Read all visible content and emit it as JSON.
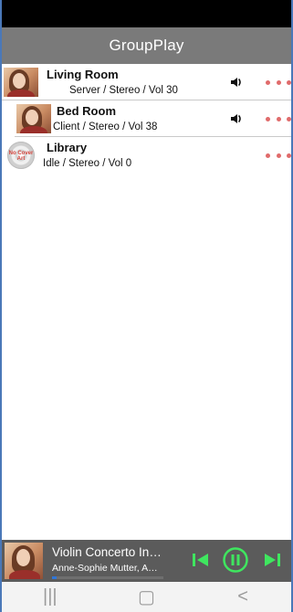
{
  "header": {
    "title": "GroupPlay"
  },
  "devices": [
    {
      "name": "Living Room",
      "status": "Server / Stereo / Vol 30",
      "artwork": "album-portrait-art",
      "volume_icon": "volume-icon",
      "more_icon": "more-options-icon"
    },
    {
      "name": "Bed Room",
      "status": "Client / Stereo / Vol 38",
      "artwork": "album-portrait-art",
      "volume_icon": "volume-icon",
      "more_icon": "more-options-icon"
    },
    {
      "name": "Library",
      "status": "Idle / Stereo / Vol 0",
      "artwork": "disc-no-cover-art",
      "artwork_label": "No Cover Art",
      "more_icon": "more-options-icon"
    }
  ],
  "player": {
    "title": "Violin Concerto In…",
    "artist": "Anne-Sophie Mutter, A…",
    "progress": 0.04,
    "controls": [
      "previous-icon",
      "pause-icon",
      "next-icon"
    ]
  },
  "navigation": {
    "recent": "|||",
    "home": "▢",
    "back": "<"
  },
  "colors": {
    "status_bar": "#000000",
    "header": "#7a7a7a",
    "more_dots": "#e06b6b",
    "player_controls": "#3fe65f",
    "player_background": "#5b5b5b",
    "progress": "#2f76d8"
  }
}
